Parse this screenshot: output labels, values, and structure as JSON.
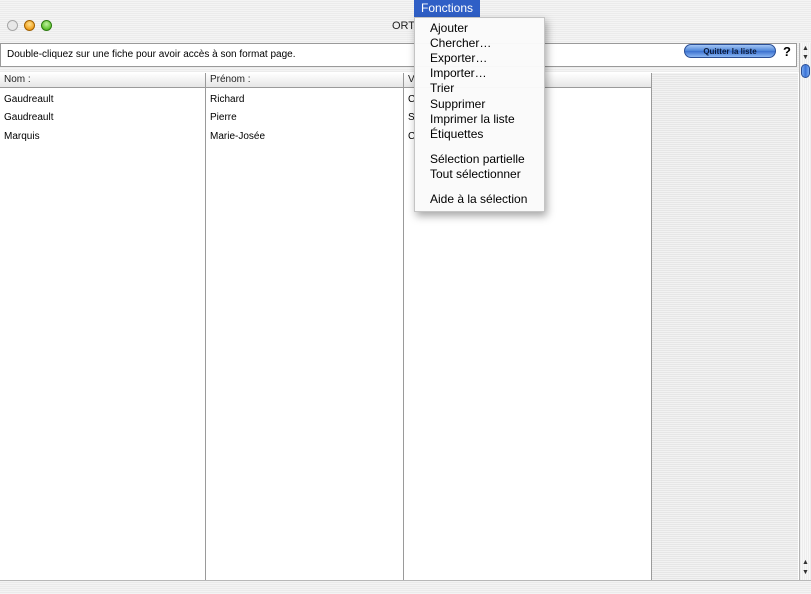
{
  "window": {
    "title": "ORT"
  },
  "toolbar": {
    "instruction": "Double-cliquez sur une fiche pour avoir accès à son format page.",
    "quit_label": "Quitter la liste",
    "help_label": "?"
  },
  "table": {
    "headers": [
      "Nom :",
      "Prénom :",
      "V"
    ],
    "rows": [
      [
        "Gaudreault",
        "Richard",
        "C"
      ],
      [
        "Gaudreault",
        "Pierre",
        "S"
      ],
      [
        "Marquis",
        "Marie-Josée",
        "C"
      ]
    ]
  },
  "menu": {
    "title": "Fonctions",
    "items": [
      "Ajouter",
      "Chercher…",
      "Exporter…",
      "Importer…",
      "Trier",
      "Supprimer",
      "Imprimer la liste",
      "Étiquettes",
      "Sélection partielle",
      "Tout sélectionner",
      "Aide à la sélection"
    ]
  },
  "colors": {
    "menu_highlight": "#2f5fc6",
    "button_blue": "#4d84d8"
  }
}
